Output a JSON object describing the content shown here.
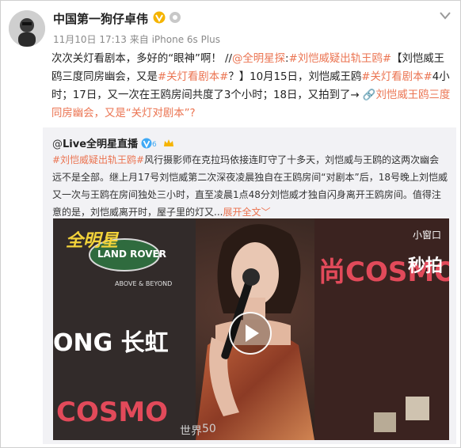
{
  "header": {
    "username": "中国第一狗仔卓伟",
    "meta": "11月10日 17:13 来自 iPhone 6s Plus",
    "verified_icon": "verified-v-icon",
    "level_icon": "member-level-icon"
  },
  "post": {
    "t1": "次次关灯看剧本，多好的“眼神”啊！ //",
    "t2": "@全明星探",
    "t3": ":",
    "t4": "#刘恺威疑出轨王鸥#",
    "t5": "【刘恺威王鸥三度同房幽会，又是",
    "t6": "#关灯看剧本#",
    "t7": "？】10月15日，刘恺威王鸥",
    "t8": "#关灯看剧本#",
    "t9": "4小时；17日，又一次在王鸥房间共度了3个小时；18日，又拍到了→",
    "t10": "刘恺威王鸥三度同房幽会，又是“关灯对剧本”?"
  },
  "repost": {
    "user_prefix": "@",
    "user_name": "Live全明星直播",
    "t1": "#刘恺威疑出轨王鸥#",
    "t2": "风行摄影师在克拉玛依接连盯守了十多天，刘恺威与王鸥的这两次幽会远不是全部。继上月17号刘恺威第二次深夜凌晨独自在王鸥房间“对剧本”后，18号晚上刘恺威又一次与王鸥在房间独处三小时，直至凌晨1点48分刘恺威才独自闪身离开王鸥房间。值得注意的是，刘恺威离开时，屋子里的灯又...",
    "expand": "展开全文",
    "expand_arrow": "﹀"
  },
  "video": {
    "small_window": "小窗口",
    "watermark_left": "全明星",
    "watermark_right": "秒拍",
    "sponsor_logo": "LAND ROVER",
    "sponsor_tagline": "ABOVE & BEYOND",
    "bg_brand_1": "尚COSMO",
    "bg_brand_2": "ONG 长虹",
    "bg_brand_3": "COSMO",
    "bg_brand_4": "世界",
    "bg_brand_5": "50"
  },
  "colors": {
    "link": "#eb7350",
    "background": "#ffffff",
    "repost_bg": "#f2f2f5"
  }
}
